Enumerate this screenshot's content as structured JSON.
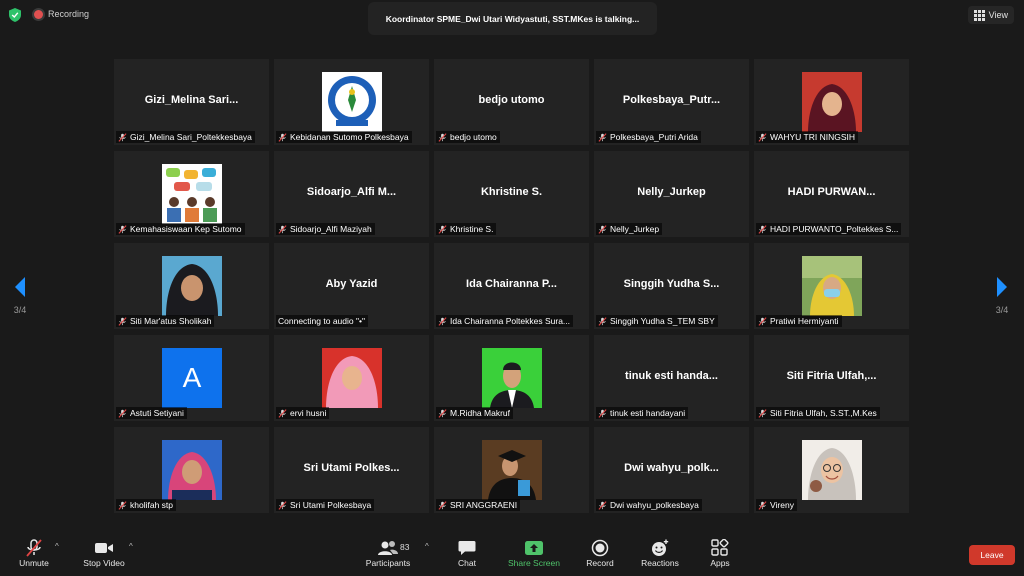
{
  "status": {
    "recording_label": "Recording"
  },
  "talking": {
    "text": "Koordinator SPME_Dwi Utari Widyastuti, SST.MKes is talking..."
  },
  "view": {
    "label": "View"
  },
  "pager": {
    "left_page": "3/4",
    "right_page": "3/4"
  },
  "participants": [
    {
      "big": "Gizi_Melina  Sari...",
      "label": "Gizi_Melina Sari_Poltekkesbaya"
    },
    {
      "image": "logo-emblem",
      "label": "Kebidanan Sutomo Polkesbaya"
    },
    {
      "big": "bedjo utomo",
      "label": "bedjo utomo"
    },
    {
      "big": "Polkesbaya_Putr...",
      "label": "Polkesbaya_Putri Arida"
    },
    {
      "image": "photo-hijab-dark",
      "label": "WAHYU TRI NINGSIH"
    },
    {
      "image": "illustration-meeting",
      "label": "Kemahasiswaan Kep Sutomo"
    },
    {
      "big": "Sidoarjo_Alfi  M...",
      "label": "Sidoarjo_Alfi Maziyah"
    },
    {
      "big": "Khristine S.",
      "label": "Khristine S."
    },
    {
      "big": "Nelly_Jurkep",
      "label": "Nelly_Jurkep"
    },
    {
      "big": "HADI  PURWAN...",
      "label": "HADI PURWANTO_Poltekkes S..."
    },
    {
      "image": "photo-hijab-black",
      "label": "Siti Mar'atus Sholikah"
    },
    {
      "big": "Aby Yazid",
      "label": "Connecting to audio \"•\"",
      "connecting": true
    },
    {
      "big": "Ida  Chairanna  P...",
      "label": "Ida Chairanna Poltekkes Sura..."
    },
    {
      "big": "Singgih  Yudha  S...",
      "label": "Singgih Yudha S_TEM SBY"
    },
    {
      "image": "photo-outdoor-mask",
      "label": "Pratiwi Hermiyanti"
    },
    {
      "image": "avatar-letter-a",
      "avatar_letter": "A",
      "label": "Astuti Setiyani"
    },
    {
      "image": "photo-pink-hijab",
      "label": "ervi husni"
    },
    {
      "image": "photo-man-green",
      "label": "M.Ridha Makruf"
    },
    {
      "big": "tinuk  esti  handa...",
      "label": "tinuk esti handayani"
    },
    {
      "big": "Siti  Fitria  Ulfah,...",
      "label": "Siti Fitria Ulfah, S.ST.,M.Kes"
    },
    {
      "image": "photo-blue-bg",
      "label": "kholifah stp"
    },
    {
      "big": "Sri  Utami  Polkes...",
      "label": "Sri Utami Polkesbaya"
    },
    {
      "image": "photo-graduation",
      "label": "SRI ANGGRAENI"
    },
    {
      "big": "Dwi  wahyu_polk...",
      "label": "Dwi wahyu_polkesbaya"
    },
    {
      "image": "photo-smile-glasses",
      "label": "Vireny"
    }
  ],
  "toolbar": {
    "unmute": "Unmute",
    "stop_video": "Stop Video",
    "participants": "Participants",
    "participants_count": "83",
    "chat": "Chat",
    "share_screen": "Share Screen",
    "record": "Record",
    "reactions": "Reactions",
    "apps": "Apps",
    "leave": "Leave"
  },
  "colors": {
    "accent": "#1e90ff",
    "share": "#4fc36a",
    "leave": "#d0392b",
    "mute": "#e04444"
  }
}
